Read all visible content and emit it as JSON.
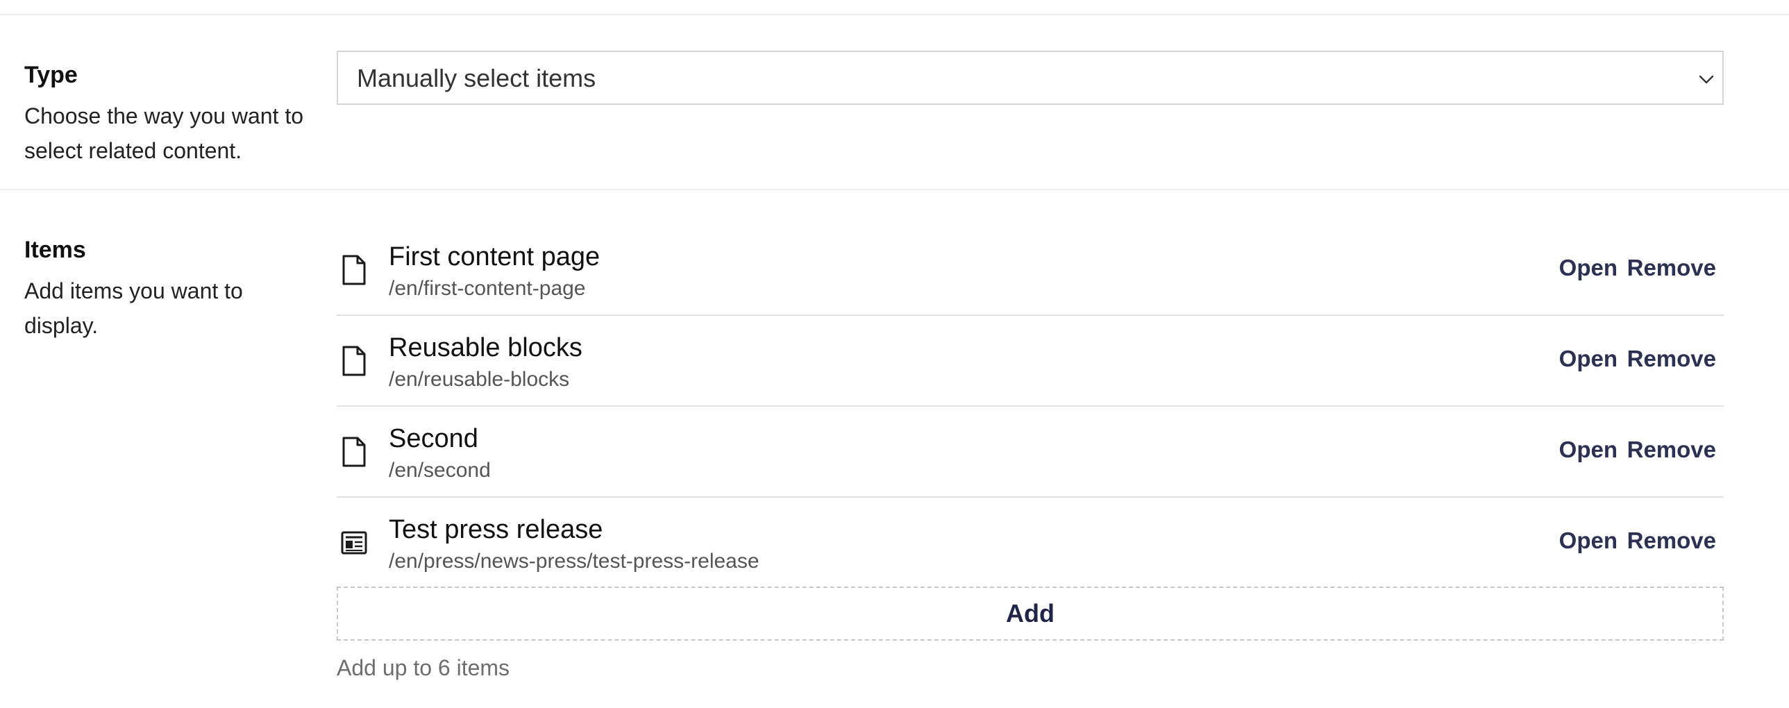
{
  "type_section": {
    "title": "Type",
    "description": "Choose the way you want to select related content.",
    "select": {
      "selected_value": "Manually select items",
      "icon": "chevron-down-icon"
    }
  },
  "items_section": {
    "title": "Items",
    "description": "Add items you want to display.",
    "items": [
      {
        "title": "First content page",
        "path": "/en/first-content-page",
        "icon": "document-icon",
        "open_label": "Open",
        "remove_label": "Remove"
      },
      {
        "title": "Reusable blocks",
        "path": "/en/reusable-blocks",
        "icon": "document-icon",
        "open_label": "Open",
        "remove_label": "Remove"
      },
      {
        "title": "Second",
        "path": "/en/second",
        "icon": "document-icon",
        "open_label": "Open",
        "remove_label": "Remove"
      },
      {
        "title": "Test press release",
        "path": "/en/press/news-press/test-press-release",
        "icon": "newspaper-icon",
        "open_label": "Open",
        "remove_label": "Remove"
      }
    ],
    "add_label": "Add",
    "help_text": "Add up to 6 items"
  }
}
